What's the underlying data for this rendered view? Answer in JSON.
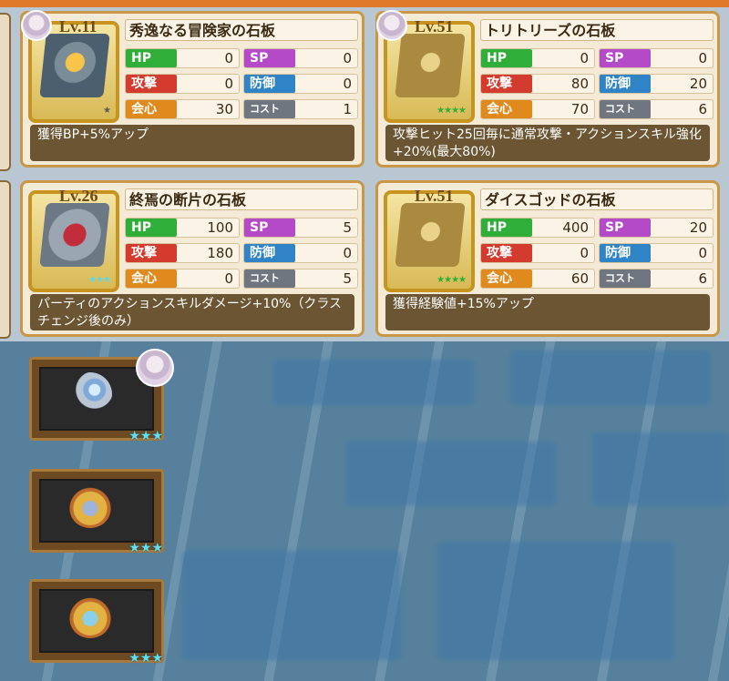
{
  "cards": [
    {
      "level": "Lv.11",
      "name": "秀逸なる冒険家の石板",
      "stars": "★",
      "stats": {
        "hp": "0",
        "sp": "0",
        "atk": "0",
        "def": "0",
        "crit": "30",
        "cost": "1"
      },
      "desc": "獲得BP+5%アップ"
    },
    {
      "level": "Lv.51",
      "name": "トリトリーズの石板",
      "stars": "★★★★",
      "stats": {
        "hp": "0",
        "sp": "0",
        "atk": "80",
        "def": "20",
        "crit": "70",
        "cost": "6"
      },
      "desc": "攻撃ヒット25回毎に通常攻撃・アクションスキル強化+20%(最大80%)"
    },
    {
      "level": "Lv.26",
      "name": "終焉の断片の石板",
      "stars": "★★★",
      "stats": {
        "hp": "100",
        "sp": "5",
        "atk": "180",
        "def": "0",
        "crit": "0",
        "cost": "5"
      },
      "desc": "パーティのアクションスキルダメージ+10%（クラスチェンジ後のみ）"
    },
    {
      "level": "Lv.51",
      "name": "ダイスゴッドの石板",
      "stars": "★★★★",
      "stats": {
        "hp": "400",
        "sp": "20",
        "atk": "0",
        "def": "0",
        "crit": "60",
        "cost": "6"
      },
      "desc": "獲得経験値+15%アップ"
    }
  ],
  "labels": {
    "hp": "HP",
    "sp": "SP",
    "atk": "攻撃",
    "def": "防御",
    "crit": "会心",
    "cost": "コスト"
  },
  "accessories": [
    {
      "icon": "ring-icon",
      "stars": "★★★"
    },
    {
      "icon": "medal-icon",
      "stars": "★★★"
    },
    {
      "icon": "medal-icon",
      "stars": "★★★"
    }
  ],
  "colors": {
    "hp": "#2fae3a",
    "sp": "#b44ac8",
    "atk": "#d33b2e",
    "def": "#2f84c8",
    "crit": "#e08a1e",
    "cost": "#6f7680"
  }
}
